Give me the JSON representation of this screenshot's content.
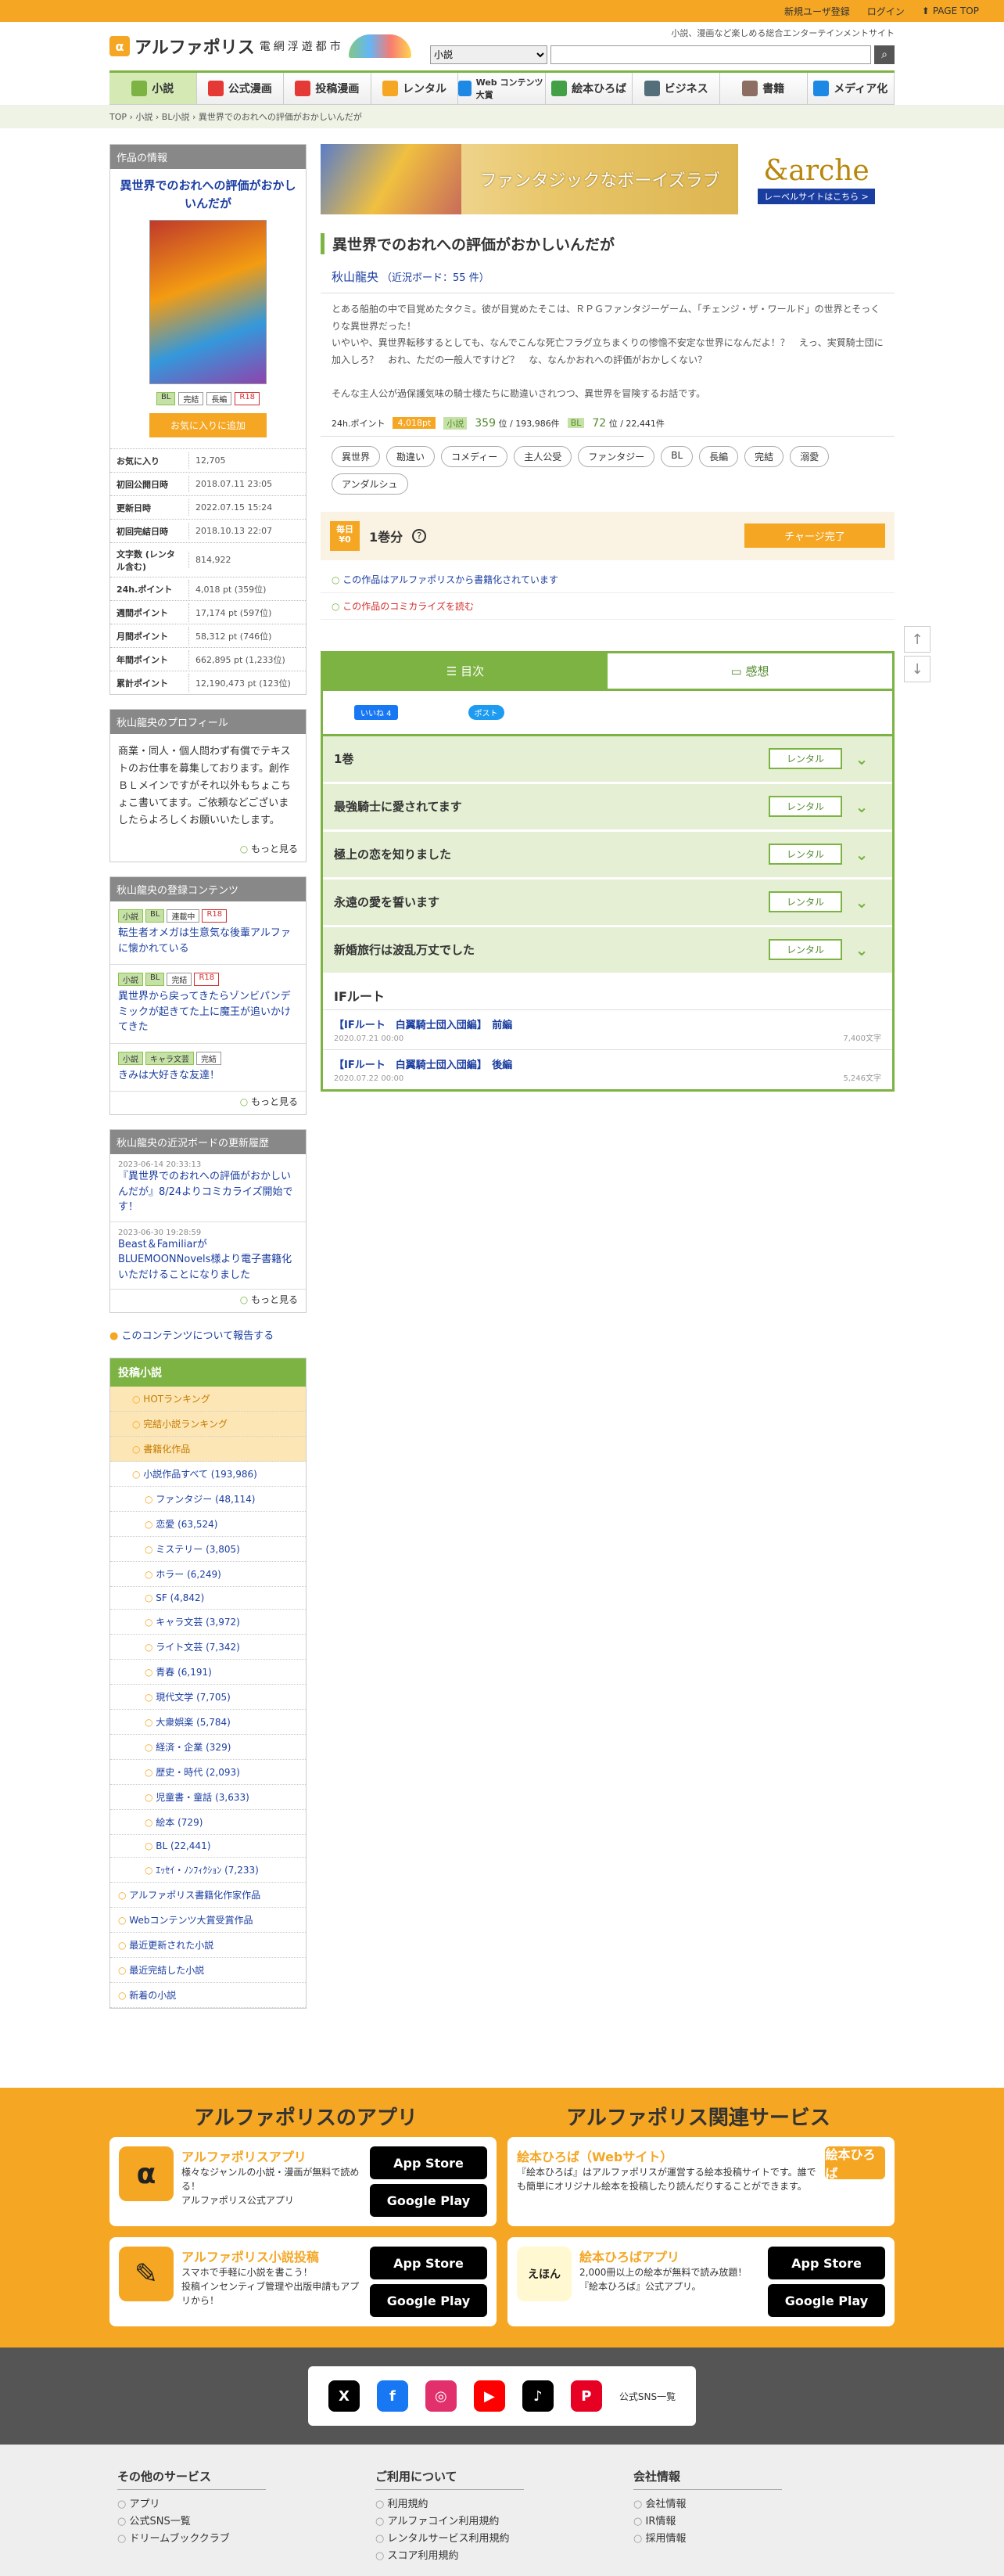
{
  "topbar": {
    "register": "新規ユーザ登録",
    "login": "ログイン",
    "pagetop": "PAGE TOP"
  },
  "header": {
    "logo": "アルファポリス",
    "logo_sub": "電網浮遊都市",
    "tagline": "小説、漫画など楽しめる総合エンターテインメントサイト",
    "search_select": "小説",
    "search_placeholder": ""
  },
  "nav": [
    "小説",
    "公式漫画",
    "投稿漫画",
    "レンタル",
    "Web コンテンツ大賞",
    "絵本ひろば",
    "ビジネス",
    "書籍",
    "メディア化"
  ],
  "breadcrumb": "TOP › 小説 › BL小説 › 異世界でのおれへの評価がおかしいんだが",
  "sidebar": {
    "info_title": "作品の情報",
    "work_title": "異世界でのおれへの評価がおかしいんだが",
    "tags": [
      "BL",
      "完結",
      "長編",
      "R18"
    ],
    "fav_button": "お気に入りに追加",
    "stats": [
      {
        "k": "お気に入り",
        "v": "12,705"
      },
      {
        "k": "初回公開日時",
        "v": "2018.07.11 23:05"
      },
      {
        "k": "更新日時",
        "v": "2022.07.15 15:24"
      },
      {
        "k": "初回完結日時",
        "v": "2018.10.13 22:07"
      },
      {
        "k": "文字数 (レンタル含む)",
        "v": "814,922"
      },
      {
        "k": "24h.ポイント",
        "v": "4,018 pt (359位)"
      },
      {
        "k": "週間ポイント",
        "v": "17,174 pt (597位)"
      },
      {
        "k": "月間ポイント",
        "v": "58,312 pt (746位)"
      },
      {
        "k": "年間ポイント",
        "v": "662,895 pt (1,233位)"
      },
      {
        "k": "累計ポイント",
        "v": "12,190,473 pt (123位)"
      }
    ],
    "profile_title": "秋山龍央のプロフィール",
    "profile_text": "商業・同人・個人問わず有償でテキストのお仕事を募集しております。創作ＢＬメインですがそれ以外もちょこちょこ書いてます。ご依頼などございましたらよろしくお願いいたします。",
    "more": "もっと見る",
    "contents_title": "秋山龍央の登録コンテンツ",
    "contents": [
      {
        "tags": [
          "小説",
          "BL",
          "連載中",
          "R18"
        ],
        "title": "転生者オメガは生意気な後輩アルファに懐かれている"
      },
      {
        "tags": [
          "小説",
          "BL",
          "完結",
          "R18"
        ],
        "title": "異世界から戻ってきたらゾンビパンデミックが起きてた上に魔王が追いかけてきた"
      },
      {
        "tags": [
          "小説",
          "キャラ文芸",
          "完結"
        ],
        "title": "きみは大好きな友達！"
      }
    ],
    "blog_title": "秋山龍央の近況ボードの更新履歴",
    "blog": [
      {
        "date": "2023-06-14 20:33:13",
        "title": "『異世界でのおれへの評価がおかしいんだが』8/24よりコミカライズ開始です！"
      },
      {
        "date": "2023-06-30 19:28:59",
        "title": "Beast＆FamiliarがBLUEMOONNovels様より電子書籍化いただけることになりました"
      }
    ],
    "report": "このコンテンツについて報告する",
    "nav_title": "投稿小説",
    "nav_items": [
      {
        "t": "HOTランキング",
        "c": "o"
      },
      {
        "t": "完結小説ランキング",
        "c": "o"
      },
      {
        "t": "書籍化作品",
        "c": "o"
      },
      {
        "t": "小説作品すべて (193,986)",
        "c": "l1"
      },
      {
        "t": "ファンタジー (48,114)",
        "c": "l2"
      },
      {
        "t": "恋愛 (63,524)",
        "c": "l2"
      },
      {
        "t": "ミステリー (3,805)",
        "c": "l2"
      },
      {
        "t": "ホラー (6,249)",
        "c": "l2"
      },
      {
        "t": "SF (4,842)",
        "c": "l2"
      },
      {
        "t": "キャラ文芸 (3,972)",
        "c": "l2"
      },
      {
        "t": "ライト文芸 (7,342)",
        "c": "l2"
      },
      {
        "t": "青春 (6,191)",
        "c": "l2"
      },
      {
        "t": "現代文学 (7,705)",
        "c": "l2"
      },
      {
        "t": "大衆娯楽 (5,784)",
        "c": "l2"
      },
      {
        "t": "経済・企業 (329)",
        "c": "l2"
      },
      {
        "t": "歴史・時代 (2,093)",
        "c": "l2"
      },
      {
        "t": "児童書・童話 (3,633)",
        "c": "l2"
      },
      {
        "t": "絵本 (729)",
        "c": "l2"
      },
      {
        "t": "BL (22,441)",
        "c": "l2"
      },
      {
        "t": "ｴｯｾｲ・ﾉﾝﾌｨｸｼｮﾝ (7,233)",
        "c": "l2"
      },
      {
        "t": "アルファポリス書籍化作家作品",
        "c": "n"
      },
      {
        "t": "Webコンテンツ大賞受賞作品",
        "c": "n"
      },
      {
        "t": "最近更新された小説",
        "c": "n"
      },
      {
        "t": "最近完結した小説",
        "c": "n"
      },
      {
        "t": "新着の小説",
        "c": "n"
      }
    ]
  },
  "main": {
    "banner_text": "ファンタジックなボーイズラブ",
    "banner_logo": "&arche",
    "banner_link": "レーベルサイトはこちら >",
    "title": "異世界でのおれへの評価がおかしいんだが",
    "author": "秋山龍央",
    "author_board": "（近況ボード：55 件）",
    "description": "とある船舶の中で目覚めたタクミ。彼が目覚めたそこは、ＲＰＧファンタジーゲーム、「チェンジ・ザ・ワールド」の世界とそっくりな異世界だった！\nいやいや、異世界転移するとしても、なんでこんな死亡フラグ立ちまくりの惨憺不安定な世界になんだよ！？　えっ、実質騎士団に加入しろ？　おれ、ただの一般人ですけど？　な、なんかおれへの評価がおかしくない？\n\nそんな主人公が過保護気味の騎士様たちに勘違いされつつ、異世界を冒険するお話です。",
    "pts_label": "24h.ポイント",
    "pts_value": "4,018pt",
    "rank1_label": "小説",
    "rank1": "359",
    "rank1_total": "位 / 193,986件",
    "rank2_label": "BL",
    "rank2": "72",
    "rank2_total": "位 / 22,441件",
    "tags": [
      "異世界",
      "勘違い",
      "コメディー",
      "主人公受",
      "ファンタジー",
      "BL",
      "長編",
      "完結",
      "溺愛",
      "アンダルシュ"
    ],
    "free_yen": "毎日 ¥0",
    "free_text": "1巻分",
    "charge": "チャージ完了",
    "notice1": "この作品はアルファポリスから書籍化されています",
    "notice2": "この作品のコミカライズを読む",
    "tab_toc": "目次",
    "tab_review": "感想",
    "fb": "いいね 4",
    "tw": "ポスト",
    "rental_label": "レンタル",
    "volumes": [
      "1巻",
      "最強騎士に愛されてます",
      "極上の恋を知りました",
      "永遠の愛を誓います",
      "新婚旅行は波乱万丈でした"
    ],
    "section": "IFルート",
    "episodes": [
      {
        "t": "【IFルート　白翼騎士団入団編】　前編",
        "d": "2020.07.21 00:00",
        "c": "7,400文字"
      },
      {
        "t": "【IFルート　白翼騎士団入団編】　後編",
        "d": "2020.07.22 00:00",
        "c": "5,246文字"
      }
    ]
  },
  "footer": {
    "apps_title": "アルファポリスのアプリ",
    "services_title": "アルファポリス関連サービス",
    "app1_name": "アルファポリスアプリ",
    "app1_desc": "様々なジャンルの小説・漫画が無料で読める！\nアルファポリス公式アプリ",
    "app2_name": "アルファポリス小説投稿",
    "app2_desc": "スマホで手軽に小説を書こう！\n投稿インセンティブ管理や出版申請もアプリから！",
    "ehon_name": "絵本ひろば（Webサイト）",
    "ehon_desc": "『絵本ひろば』はアルファポリスが運営する絵本投稿サイトです。誰でも簡単にオリジナル絵本を投稿したり読んだりすることができます。",
    "ehon_btn": "絵本ひろば",
    "ehon_app_name": "絵本ひろばアプリ",
    "ehon_app_desc": "2,000冊以上の絵本が無料で読み放題！\n『絵本ひろば』公式アプリ。",
    "appstore": "App Store",
    "googleplay": "Google Play",
    "sns_link": "公式SNS一覧",
    "col1_title": "その他のサービス",
    "col1": [
      "アプリ",
      "公式SNS一覧",
      "ドリームブッククラブ"
    ],
    "col2_title": "ご利用について",
    "col2": [
      "利用規約",
      "アルファコイン利用規約",
      "レンタルサービス利用規約",
      "スコア利用規約"
    ],
    "col3_title": "会社情報",
    "col3": [
      "会社情報",
      "IR情報",
      "採用情報"
    ]
  }
}
